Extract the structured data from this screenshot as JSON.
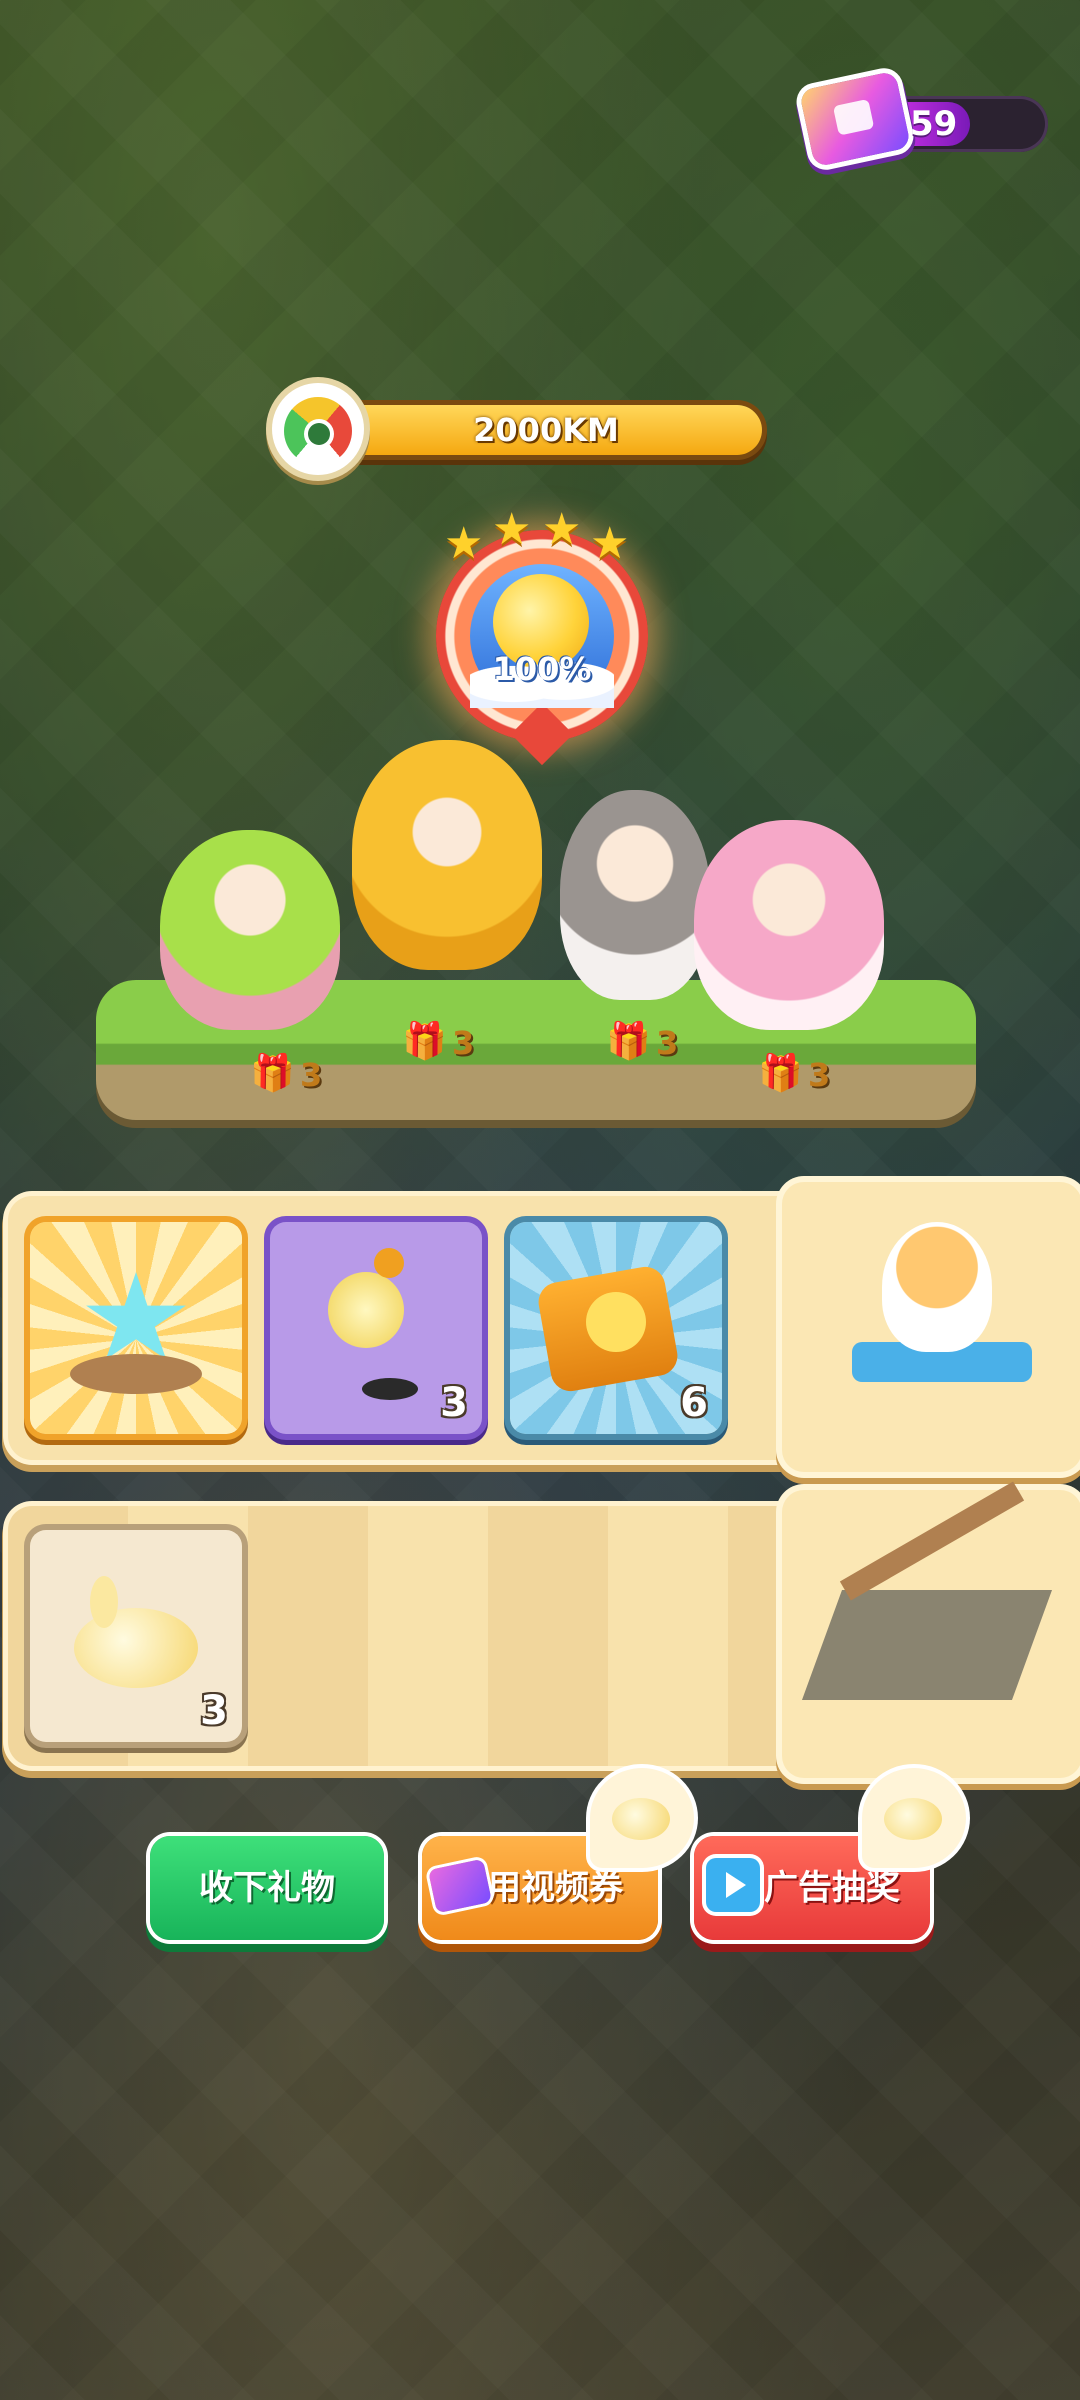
{
  "hud": {
    "ticket_count": "59",
    "distance": "2000KM"
  },
  "medal": {
    "stars": 4,
    "percent": "100%"
  },
  "characters": [
    {
      "name_icon": "green-bunny-girl",
      "gift_count": "3"
    },
    {
      "name_icon": "golden-fox-girl",
      "gift_count": "3"
    },
    {
      "name_icon": "gray-haired-cat-girl",
      "gift_count": "3"
    },
    {
      "name_icon": "pink-haired-cat-girl",
      "gift_count": "3"
    }
  ],
  "rewards_row1": [
    {
      "icon": "blue-star-crystal",
      "count": ""
    },
    {
      "icon": "duck-lamp",
      "count": "3"
    },
    {
      "icon": "ring-box-duckling",
      "count": "6"
    }
  ],
  "rewards_row2": [
    {
      "icon": "bunny-cushion",
      "count": "3"
    }
  ],
  "side_cards": [
    {
      "icon": "cat-on-bench"
    },
    {
      "icon": "trapdoor-stairs"
    }
  ],
  "buttons": {
    "collect": "收下礼物",
    "video_ticket": "用视频券",
    "ad_lottery": "广告抽奖"
  },
  "colors": {
    "green_button": "#18b45a",
    "orange_button": "#f08a1a",
    "red_button": "#e83a3a",
    "panel": "#f8e2ac"
  }
}
